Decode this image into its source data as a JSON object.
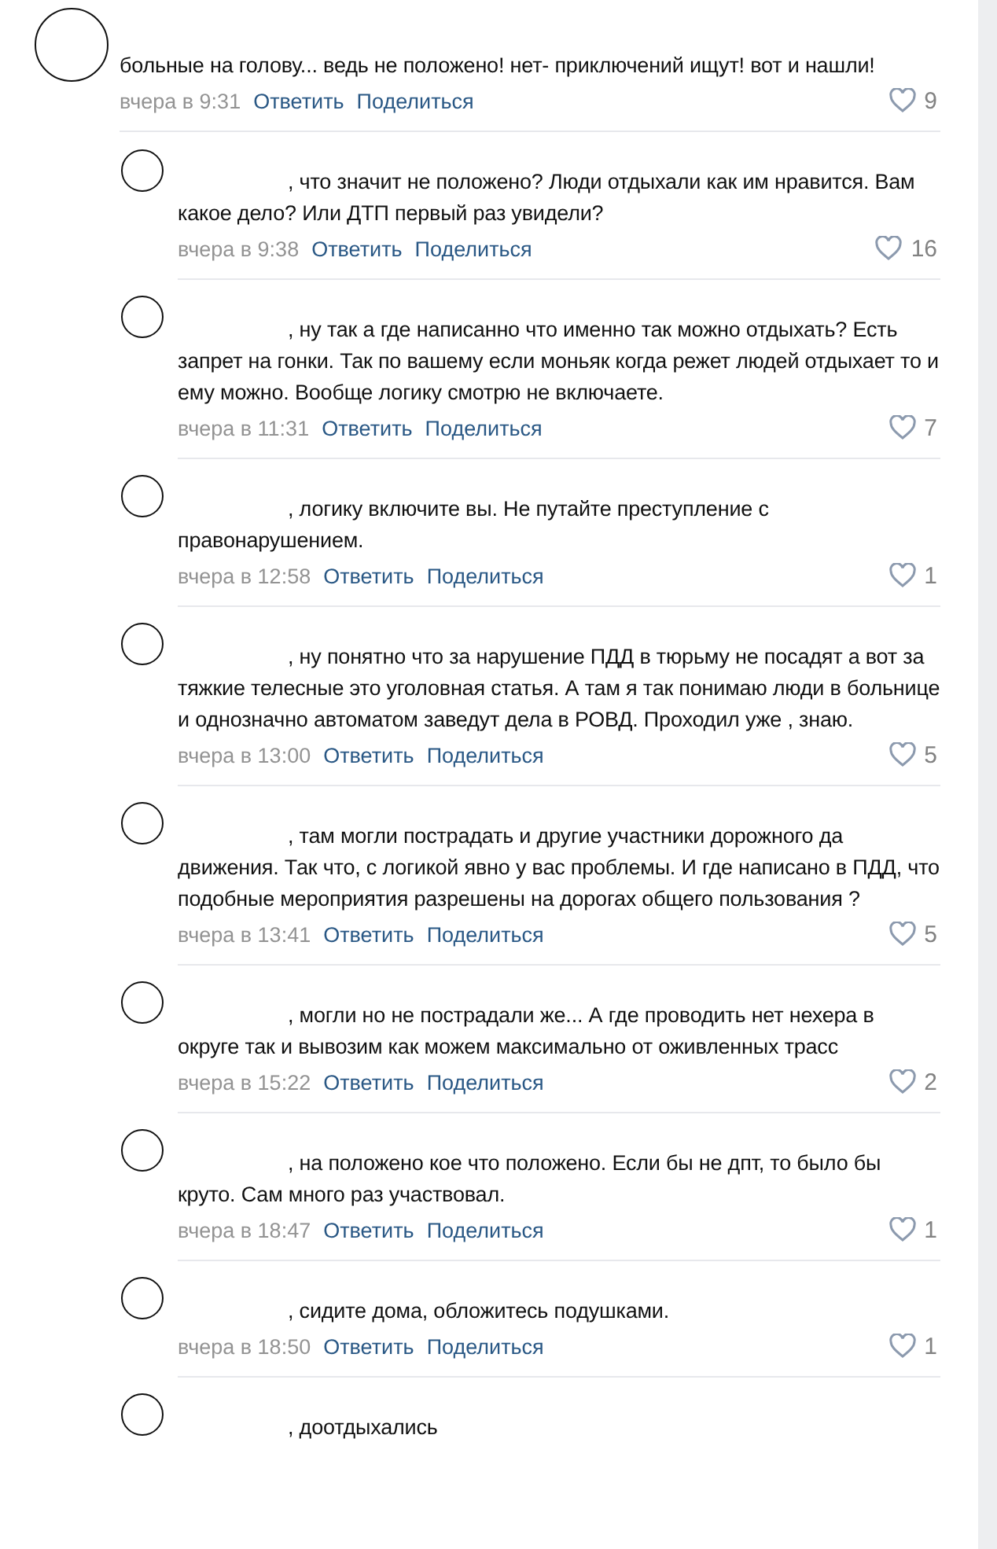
{
  "comment": {
    "text": "больные на голову... ведь не положено! нет- приключений ищут! вот и нашли!",
    "time": "вчера в 9:31",
    "reply_label": "Ответить",
    "share_label": "Поделиться",
    "likes": "9",
    "replies": [
      {
        "text": ", что значит не положено? Люди отдыхали как им нравится. Вам какое дело? Или ДТП первый раз увидели?",
        "time": "вчера в 9:38",
        "reply_label": "Ответить",
        "share_label": "Поделиться",
        "likes": "16"
      },
      {
        "text": ", ну так а где написанно что именно так можно отдыхать? Есть запрет на гонки. Так по вашему если моньяк когда режет людей отдыхает то и ему можно. Вообще логику смотрю не включаете.",
        "time": "вчера в 11:31",
        "reply_label": "Ответить",
        "share_label": "Поделиться",
        "likes": "7"
      },
      {
        "text": ", логику включите вы. Не путайте преступление с правонарушением.",
        "time": "вчера в 12:58",
        "reply_label": "Ответить",
        "share_label": "Поделиться",
        "likes": "1"
      },
      {
        "text": ", ну понятно что за нарушение ПДД в тюрьму не посадят а вот за тяжкие телесные это уголовная статья. А там я так понимаю люди в больнице и однозначно автоматом заведут дела в РОВД. Проходил уже , знаю.",
        "time": "вчера в 13:00",
        "reply_label": "Ответить",
        "share_label": "Поделиться",
        "likes": "5"
      },
      {
        "text": ", там могли пострадать и другие участники дорожного да движения. Так что, с логикой явно у вас проблемы. И где написано в ПДД, что подобные мероприятия разрешены на дорогах общего пользования ?",
        "time": "вчера в 13:41",
        "reply_label": "Ответить",
        "share_label": "Поделиться",
        "likes": "5"
      },
      {
        "text": ", могли но не пострадали же... А где проводить нет нехера в округе так и вывозим как можем максимально от оживленных трасс",
        "time": "вчера в 15:22",
        "reply_label": "Ответить",
        "share_label": "Поделиться",
        "likes": "2"
      },
      {
        "text": ", на положено кое что положено. Если бы не дпт, то было бы круто. Сам много раз участвовал.",
        "time": "вчера в 18:47",
        "reply_label": "Ответить",
        "share_label": "Поделиться",
        "likes": "1"
      },
      {
        "text": ", сидите дома, обложитесь подушками.",
        "time": "вчера в 18:50",
        "reply_label": "Ответить",
        "share_label": "Поделиться",
        "likes": "1"
      },
      {
        "text": ", доотдыхались"
      }
    ]
  }
}
